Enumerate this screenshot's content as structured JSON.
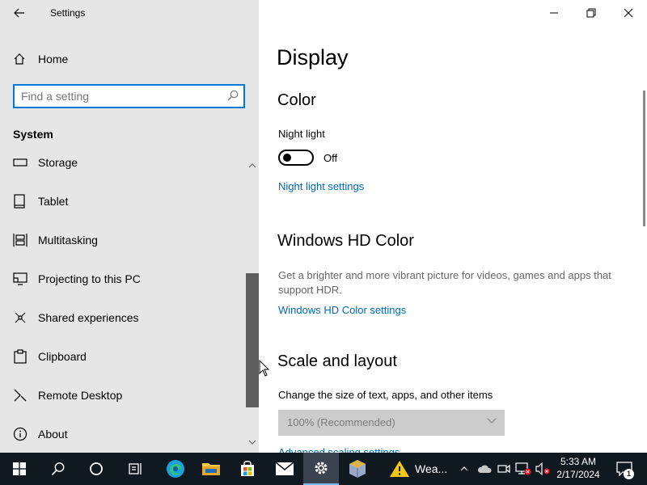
{
  "app": {
    "title": "Settings"
  },
  "nav": {
    "home_label": "Home",
    "search_placeholder": "Find a setting",
    "section_label": "System",
    "items": [
      {
        "label": "Storage",
        "icon": "storage-icon"
      },
      {
        "label": "Tablet",
        "icon": "tablet-icon"
      },
      {
        "label": "Multitasking",
        "icon": "multitasking-icon"
      },
      {
        "label": "Projecting to this PC",
        "icon": "projecting-icon"
      },
      {
        "label": "Shared experiences",
        "icon": "shared-experiences-icon"
      },
      {
        "label": "Clipboard",
        "icon": "clipboard-icon"
      },
      {
        "label": "Remote Desktop",
        "icon": "remote-desktop-icon"
      },
      {
        "label": "About",
        "icon": "info-icon"
      }
    ]
  },
  "content": {
    "page_title": "Display",
    "color": {
      "heading": "Color",
      "night_light_label": "Night light",
      "toggle_state": "Off",
      "night_light_link": "Night light settings"
    },
    "hd_color": {
      "heading": "Windows HD Color",
      "description": "Get a brighter and more vibrant picture for videos, games and apps that support HDR.",
      "link": "Windows HD Color settings"
    },
    "scale": {
      "heading": "Scale and layout",
      "change_size_label": "Change the size of text, apps, and other items",
      "selected_value": "100% (Recommended)",
      "advanced_link": "Advanced scaling settings"
    }
  },
  "taskbar": {
    "weather_text": "Wea...",
    "time": "5:33 AM",
    "date": "2/17/2024",
    "notification_count": "1"
  },
  "colors": {
    "accent": "#0078d7",
    "link": "#0067b8",
    "nav_bg": "#e6e6e6",
    "taskbar_bg": "#101820"
  }
}
